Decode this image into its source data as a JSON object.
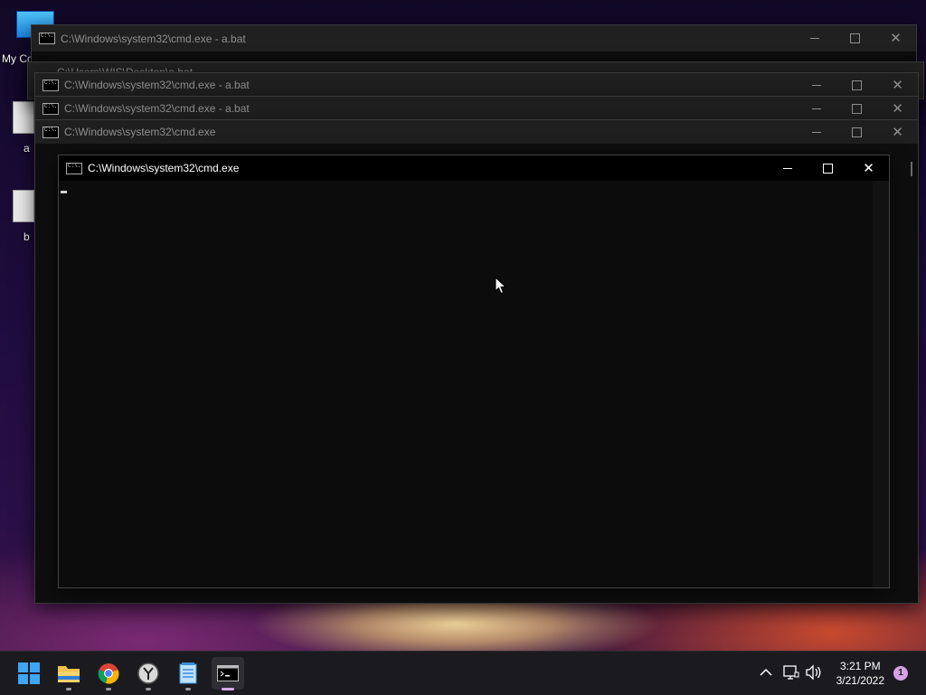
{
  "desktop": {
    "icons": [
      {
        "label": "My Co"
      },
      {
        "label": "a"
      },
      {
        "label": "b"
      }
    ]
  },
  "windows": [
    {
      "title": "C:\\Windows\\system32\\cmd.exe - a.bat"
    },
    {
      "title": "C:\\Users\\WIS\\Desktop\\a.bat"
    },
    {
      "title": "C:\\Windows\\system32\\cmd.exe - a.bat"
    },
    {
      "title": "C:\\Windows\\system32\\cmd.exe - a.bat"
    },
    {
      "title": "C:\\Windows\\system32\\cmd.exe"
    },
    {
      "title": "C:\\Windows\\system32\\cmd.exe"
    }
  ],
  "taskbar": {
    "apps": [
      "start-icon",
      "file-explorer-icon",
      "chrome-icon",
      "clock-app-icon",
      "notepad-icon",
      "terminal-icon"
    ],
    "clock": {
      "time": "3:21 PM",
      "date": "3/21/2022"
    },
    "notification_count": "1"
  },
  "colors": {
    "accent": "#d8a6e8",
    "taskbar": "#1b1b1f",
    "console": "#0c0c0c"
  }
}
